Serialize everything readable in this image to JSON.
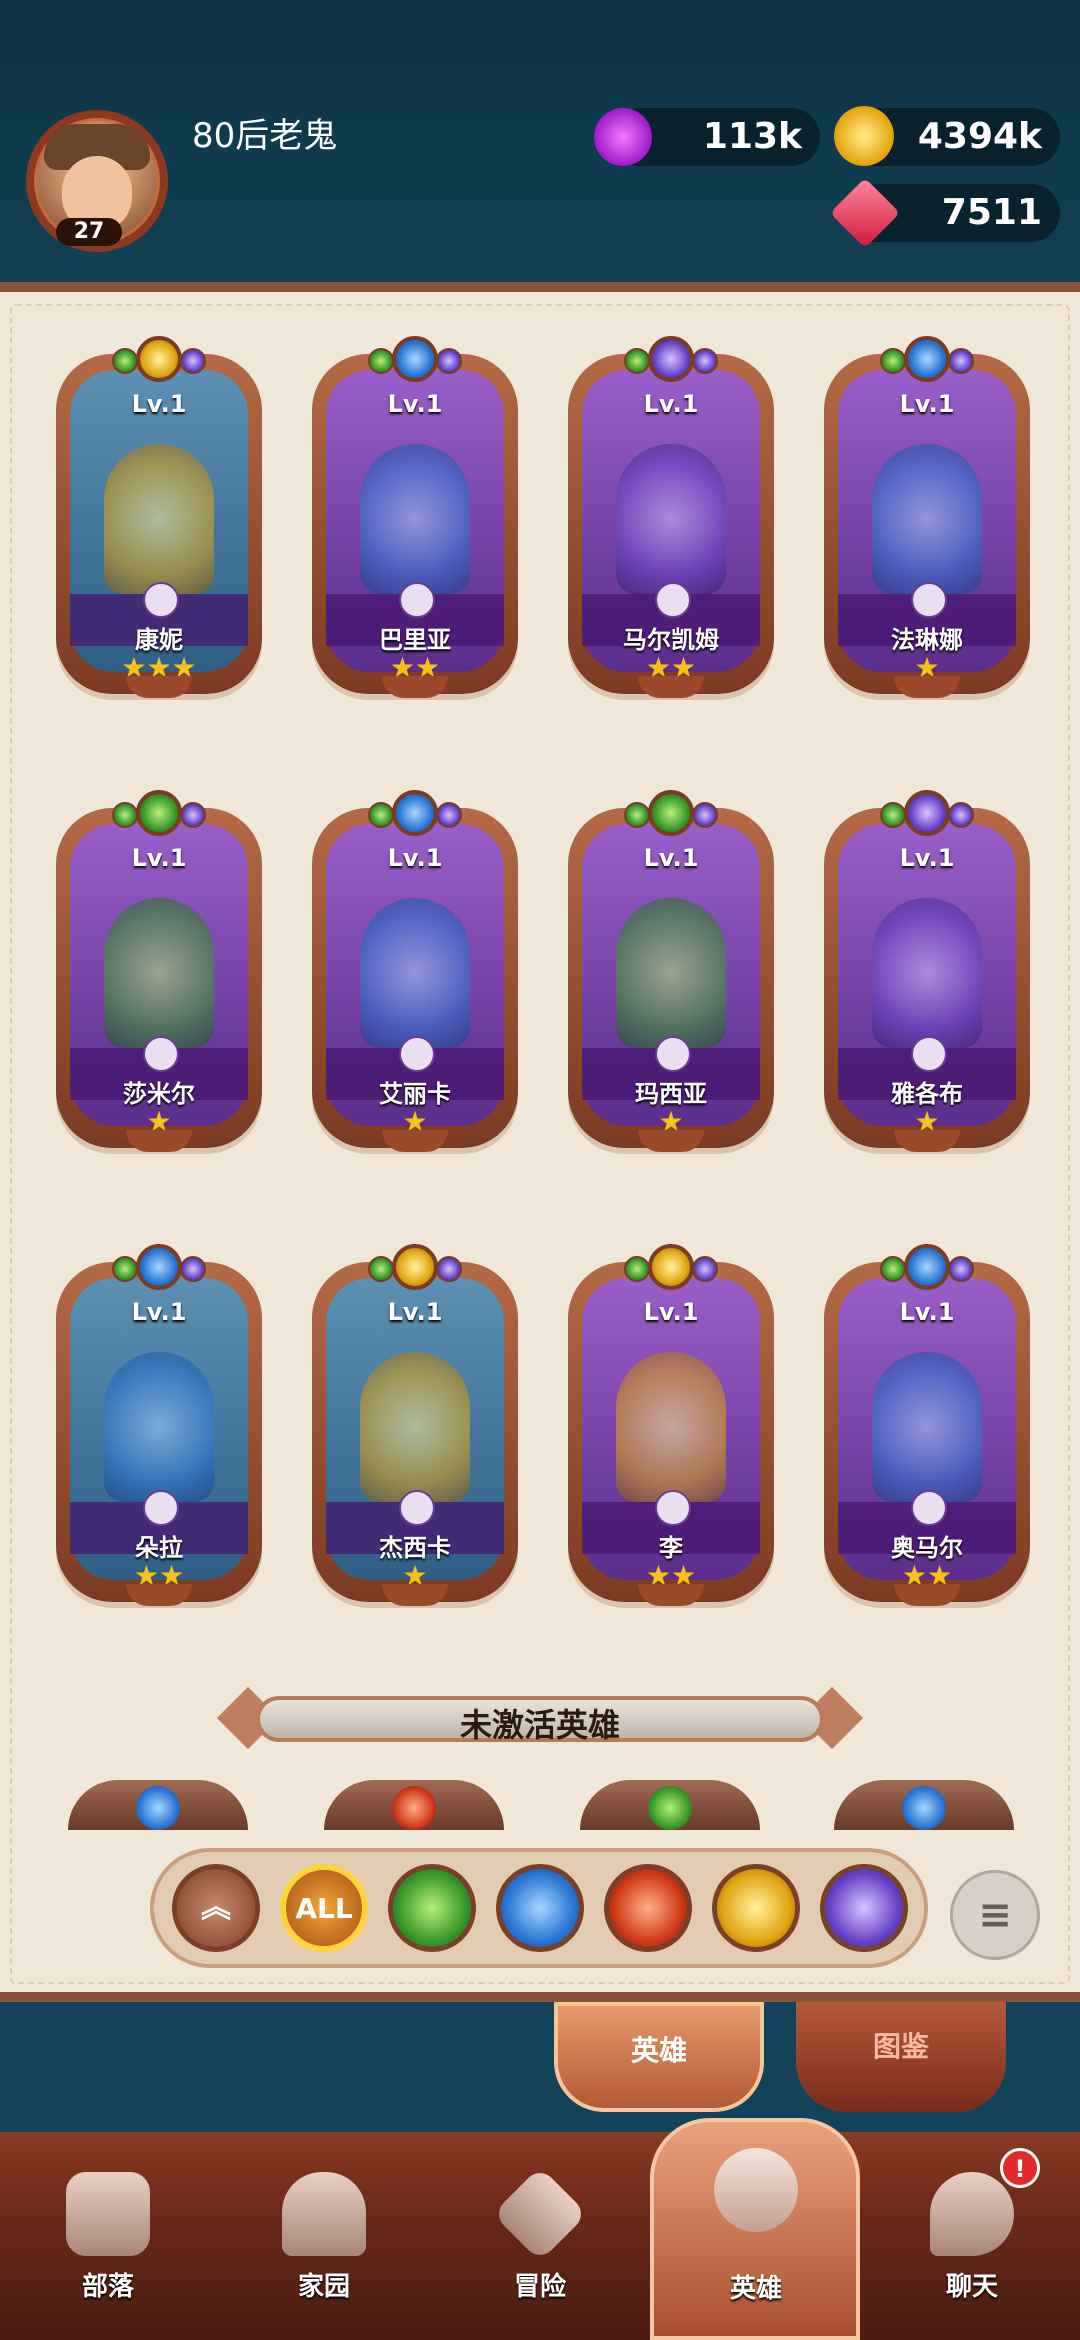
{
  "player": {
    "name": "80后老鬼",
    "level": "27"
  },
  "resources": {
    "elixir": "113k",
    "gold": "4394k",
    "gems": "7511"
  },
  "heroes": [
    {
      "level_label": "Lv.1",
      "name": "康妮",
      "stars": "★★★",
      "stars_count": 3,
      "element": "light",
      "bg": "blue"
    },
    {
      "level_label": "Lv.1",
      "name": "巴里亚",
      "stars": "★★",
      "stars_count": 2,
      "element": "water",
      "bg": "purple"
    },
    {
      "level_label": "Lv.1",
      "name": "马尔凯姆",
      "stars": "★★",
      "stars_count": 2,
      "element": "dark",
      "bg": "purple"
    },
    {
      "level_label": "Lv.1",
      "name": "法琳娜",
      "stars": "★",
      "stars_count": 1,
      "element": "water",
      "bg": "purple"
    },
    {
      "level_label": "Lv.1",
      "name": "莎米尔",
      "stars": "★",
      "stars_count": 1,
      "element": "nature",
      "bg": "purple"
    },
    {
      "level_label": "Lv.1",
      "name": "艾丽卡",
      "stars": "★",
      "stars_count": 1,
      "element": "water",
      "bg": "purple"
    },
    {
      "level_label": "Lv.1",
      "name": "玛西亚",
      "stars": "★",
      "stars_count": 1,
      "element": "nature",
      "bg": "purple"
    },
    {
      "level_label": "Lv.1",
      "name": "雅各布",
      "stars": "★",
      "stars_count": 1,
      "element": "dark",
      "bg": "purple"
    },
    {
      "level_label": "Lv.1",
      "name": "朵拉",
      "stars": "★★",
      "stars_count": 2,
      "element": "water",
      "bg": "blue"
    },
    {
      "level_label": "Lv.1",
      "name": "杰西卡",
      "stars": "★",
      "stars_count": 1,
      "element": "light",
      "bg": "blue"
    },
    {
      "level_label": "Lv.1",
      "name": "李",
      "stars": "★★",
      "stars_count": 2,
      "element": "light",
      "bg": "purple"
    },
    {
      "level_label": "Lv.1",
      "name": "奥马尔",
      "stars": "★★",
      "stars_count": 2,
      "element": "water",
      "bg": "purple"
    }
  ],
  "inactive_section": {
    "title": "未激活英雄",
    "elements": [
      "water",
      "fire",
      "nature",
      "water"
    ]
  },
  "filters": {
    "all_label": "ALL",
    "up_glyph": "︽",
    "sort_glyph": "≡",
    "elements": [
      "nature",
      "water",
      "fire",
      "light",
      "dark"
    ]
  },
  "tabs": {
    "heroes": "英雄",
    "codex": "图鉴"
  },
  "nav": [
    {
      "label": "部落",
      "icon": "tribe-icon"
    },
    {
      "label": "家园",
      "icon": "home-icon"
    },
    {
      "label": "冒险",
      "icon": "adventure-icon"
    },
    {
      "label": "英雄",
      "icon": "hero-icon"
    },
    {
      "label": "聊天",
      "icon": "chat-icon"
    }
  ],
  "notification": "!",
  "colors": {
    "light": "#e1a613",
    "water": "#2a77d4",
    "dark": "#6a45c9",
    "nature": "#3a9a2a",
    "fire": "#d23a1a",
    "accent": "#8a3a22"
  }
}
